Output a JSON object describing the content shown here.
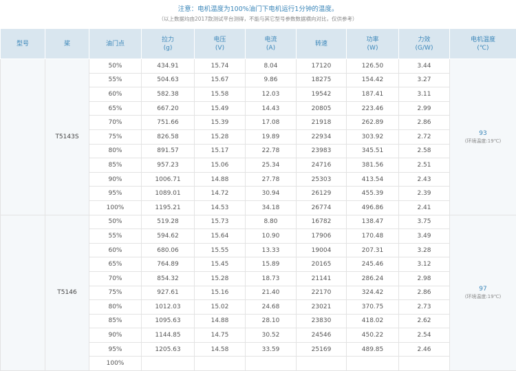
{
  "notes": {
    "main": "注意：电机温度为100%油门下电机运行1分钟的温度。",
    "sub": "（以上数据均由2017款测试平台测得，不能与其它型号参数数据横向对比，仅供参考）"
  },
  "headers": [
    [
      "型号"
    ],
    [
      "桨"
    ],
    [
      "油门点"
    ],
    [
      "拉力",
      "(g)"
    ],
    [
      "电压",
      "(V)"
    ],
    [
      "电流",
      "(A)"
    ],
    [
      "转速"
    ],
    [
      "功率",
      "(W)"
    ],
    [
      "力效",
      "(G/W)"
    ],
    [
      "电机温度",
      "(℃)"
    ]
  ],
  "groups": [
    {
      "prop": "T5143S",
      "temp": "93",
      "env": "(环境温度:19℃)",
      "rows": [
        [
          "50%",
          "434.91",
          "15.74",
          "8.04",
          "17120",
          "126.50",
          "3.44"
        ],
        [
          "55%",
          "504.63",
          "15.67",
          "9.86",
          "18275",
          "154.42",
          "3.27"
        ],
        [
          "60%",
          "582.38",
          "15.58",
          "12.03",
          "19542",
          "187.41",
          "3.11"
        ],
        [
          "65%",
          "667.20",
          "15.49",
          "14.43",
          "20805",
          "223.46",
          "2.99"
        ],
        [
          "70%",
          "751.66",
          "15.39",
          "17.08",
          "21918",
          "262.89",
          "2.86"
        ],
        [
          "75%",
          "826.58",
          "15.28",
          "19.89",
          "22934",
          "303.92",
          "2.72"
        ],
        [
          "80%",
          "891.57",
          "15.17",
          "22.78",
          "23983",
          "345.51",
          "2.58"
        ],
        [
          "85%",
          "957.23",
          "15.06",
          "25.34",
          "24716",
          "381.56",
          "2.51"
        ],
        [
          "90%",
          "1006.71",
          "14.88",
          "27.78",
          "25303",
          "413.54",
          "2.43"
        ],
        [
          "95%",
          "1089.01",
          "14.72",
          "30.94",
          "26129",
          "455.39",
          "2.39"
        ],
        [
          "100%",
          "1195.21",
          "14.53",
          "34.18",
          "26774",
          "496.86",
          "2.41"
        ]
      ]
    },
    {
      "prop": "T5146",
      "temp": "97",
      "env": "(环境温度:19℃)",
      "rows": [
        [
          "50%",
          "519.28",
          "15.73",
          "8.80",
          "16782",
          "138.47",
          "3.75"
        ],
        [
          "55%",
          "594.62",
          "15.64",
          "10.90",
          "17906",
          "170.48",
          "3.49"
        ],
        [
          "60%",
          "680.06",
          "15.55",
          "13.33",
          "19004",
          "207.31",
          "3.28"
        ],
        [
          "65%",
          "764.89",
          "15.45",
          "15.89",
          "20165",
          "245.46",
          "3.12"
        ],
        [
          "70%",
          "854.32",
          "15.28",
          "18.73",
          "21141",
          "286.24",
          "2.98"
        ],
        [
          "75%",
          "927.61",
          "15.16",
          "21.40",
          "22170",
          "324.42",
          "2.86"
        ],
        [
          "80%",
          "1012.03",
          "15.02",
          "24.68",
          "23021",
          "370.75",
          "2.73"
        ],
        [
          "85%",
          "1095.63",
          "14.88",
          "28.10",
          "23830",
          "418.02",
          "2.62"
        ],
        [
          "90%",
          "1144.85",
          "14.75",
          "30.52",
          "24546",
          "450.22",
          "2.54"
        ],
        [
          "95%",
          "1205.63",
          "14.58",
          "33.59",
          "25169",
          "489.85",
          "2.46"
        ],
        [
          "100%",
          "",
          "",
          "",
          "",
          "",
          ""
        ]
      ]
    }
  ]
}
